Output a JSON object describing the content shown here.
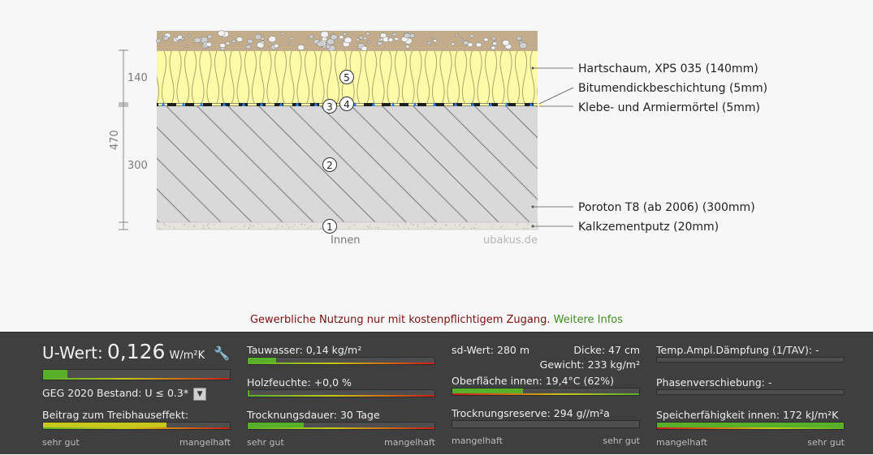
{
  "diagram": {
    "dims": {
      "d140": "140",
      "d300": "300",
      "d470": "470"
    },
    "markers": [
      "5",
      "3",
      "4",
      "2",
      "1"
    ],
    "layer_labels": [
      "Hartschaum, XPS 035 (140mm)",
      "Bitumendickbeschichtung (5mm)",
      "Klebe- und Armiermörtel (5mm)",
      "Poroton T8 (ab 2006) (300mm)",
      "Kalkzementputz (20mm)"
    ],
    "inside_label": "Innen",
    "watermark": "ubakus.de"
  },
  "notice": {
    "text": "Gewerbliche Nutzung nur mit kostenpflichtigem Zugang.",
    "link": "Weitere Infos"
  },
  "panel": {
    "uwert": {
      "label": "U-Wert:",
      "value": "0,126",
      "unit": "W/m²K",
      "fill": 0.13
    },
    "geg": {
      "label": "GEG 2020 Bestand: U ≤ 0.3*"
    },
    "treibhaus": {
      "label": "Beitrag zum Treibhauseffekt:",
      "fill": 0.66
    },
    "col1_scale": {
      "left": "sehr gut",
      "right": "mangelhaft"
    },
    "tauwasser": {
      "label": "Tauwasser: 0,14 kg/m²",
      "fill": 0.15
    },
    "holzfeuchte": {
      "label": "Holzfeuchte: +0,0 %",
      "fill": 0.01
    },
    "trocknungsdauer": {
      "label": "Trocknungsdauer: 30 Tage",
      "fill": 0.3
    },
    "col2_scale": {
      "left": "sehr gut",
      "right": "mangelhaft"
    },
    "sdwert": {
      "label": "sd-Wert: 280 m"
    },
    "dicke": {
      "label": "Dicke: 47 cm"
    },
    "gewicht": {
      "label": "Gewicht: 233 kg/m²"
    },
    "oberflaeche": {
      "label": "Oberfläche innen: 19,4°C (62%)",
      "fill": 0.38
    },
    "trocknungsreserve": {
      "label": "Trocknungsreserve: 294 g//m²a",
      "fill": 0.0
    },
    "col3_scale": {
      "left": "mangelhaft",
      "right": "sehr gut"
    },
    "tav": {
      "label": "Temp.Ampl.Dämpfung (1/TAV): -",
      "fill": 0.0
    },
    "phase": {
      "label": "Phasenverschiebung: -",
      "fill": 0.0
    },
    "speicher": {
      "label": "Speicherfähigkeit innen: 172 kJ/m²K",
      "fill": 1.0
    },
    "col4_scale": {
      "left": "mangelhaft",
      "right": "sehr gut"
    }
  },
  "colors": {
    "good": "#58b02a",
    "warn": "#c8c81c",
    "bad": "#c81c1c",
    "link": "#3e8e1e",
    "notice": "#7a1010"
  }
}
